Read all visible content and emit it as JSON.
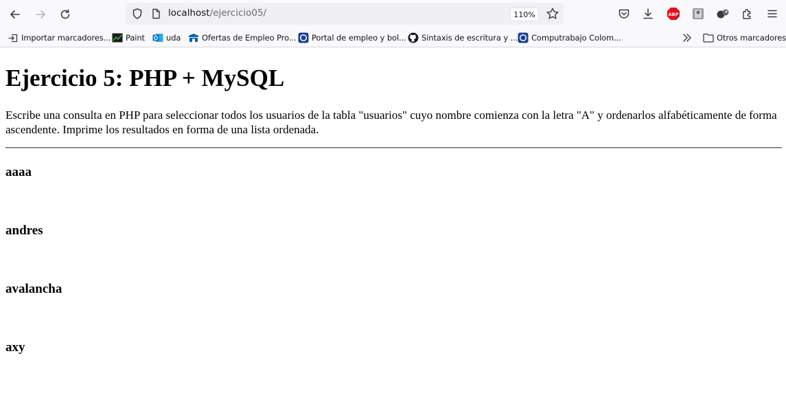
{
  "browser": {
    "url_host": "localhost",
    "url_path": "/ejercicio05/",
    "zoom": "110%",
    "extensions": {
      "abp_label": "ABP"
    }
  },
  "bookmarks": {
    "items": [
      {
        "label": "Importar marcadores...",
        "icon": "import-icon"
      },
      {
        "label": "Paint",
        "icon": "paint-icon"
      },
      {
        "label": "uda",
        "icon": "outlook-icon"
      },
      {
        "label": "Ofertas de Empleo Pro...",
        "icon": "job-site-icon"
      },
      {
        "label": "Portal de empleo y bol...",
        "icon": "computrabajo-icon"
      },
      {
        "label": "Sintaxis de escritura y ...",
        "icon": "github-icon"
      },
      {
        "label": "Computrabajo Colom...",
        "icon": "computrabajo-icon"
      }
    ],
    "other_folder": "Otros marcadores"
  },
  "page": {
    "title": "Ejercicio 5: PHP + MySQL",
    "description": "Escribe una consulta en PHP para seleccionar todos los usuarios de la tabla \"usuarios\" cuyo nombre comienza con la letra \"A\" y ordenarlos alfabéticamente de forma ascendente. Imprime los resultados en forma de una lista ordenada.",
    "users": [
      "aaaa",
      "andres",
      "avalancha",
      "axy"
    ]
  },
  "colors": {
    "toolbar_bg": "#f9f9fb",
    "urlbar_bg": "#f0f0f4",
    "abp_red": "#e3101e",
    "outlook_blue": "#0f6cbd",
    "computrabajo_blue": "#1b3f8f"
  }
}
